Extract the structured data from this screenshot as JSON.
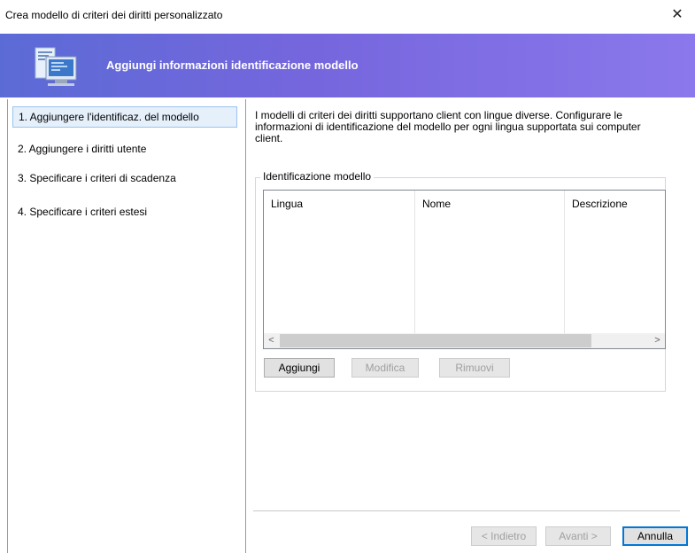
{
  "window": {
    "title": "Crea modello di criteri dei diritti personalizzato",
    "close_glyph": "✕"
  },
  "banner": {
    "title": "Aggiungi informazioni identificazione modello",
    "icon": "computer-document-icon",
    "gradient_start": "#5b6bd6",
    "gradient_end": "#8a78ec"
  },
  "steps": [
    {
      "label": "1. Aggiungere l'identificaz. del modello",
      "active": true
    },
    {
      "label": "2. Aggiungere i diritti utente",
      "active": false
    },
    {
      "label": "3. Specificare i criteri di scadenza",
      "active": false
    },
    {
      "label": "4. Specificare i criteri estesi",
      "active": false
    }
  ],
  "main": {
    "description": "I modelli di criteri dei diritti supportano client con lingue diverse. Configurare le informazioni di identificazione del modello per ogni lingua supportata sui computer client.",
    "group_title": "Identificazione modello",
    "columns": [
      "Lingua",
      "Nome",
      "Descrizione"
    ],
    "rows": [],
    "scroll_left": "<",
    "scroll_right": ">",
    "buttons": {
      "add": "Aggiungi",
      "edit": "Modifica",
      "remove": "Rimuovi"
    }
  },
  "footer": {
    "back": "< Indietro",
    "next": "Avanti >",
    "cancel": "Annulla"
  }
}
